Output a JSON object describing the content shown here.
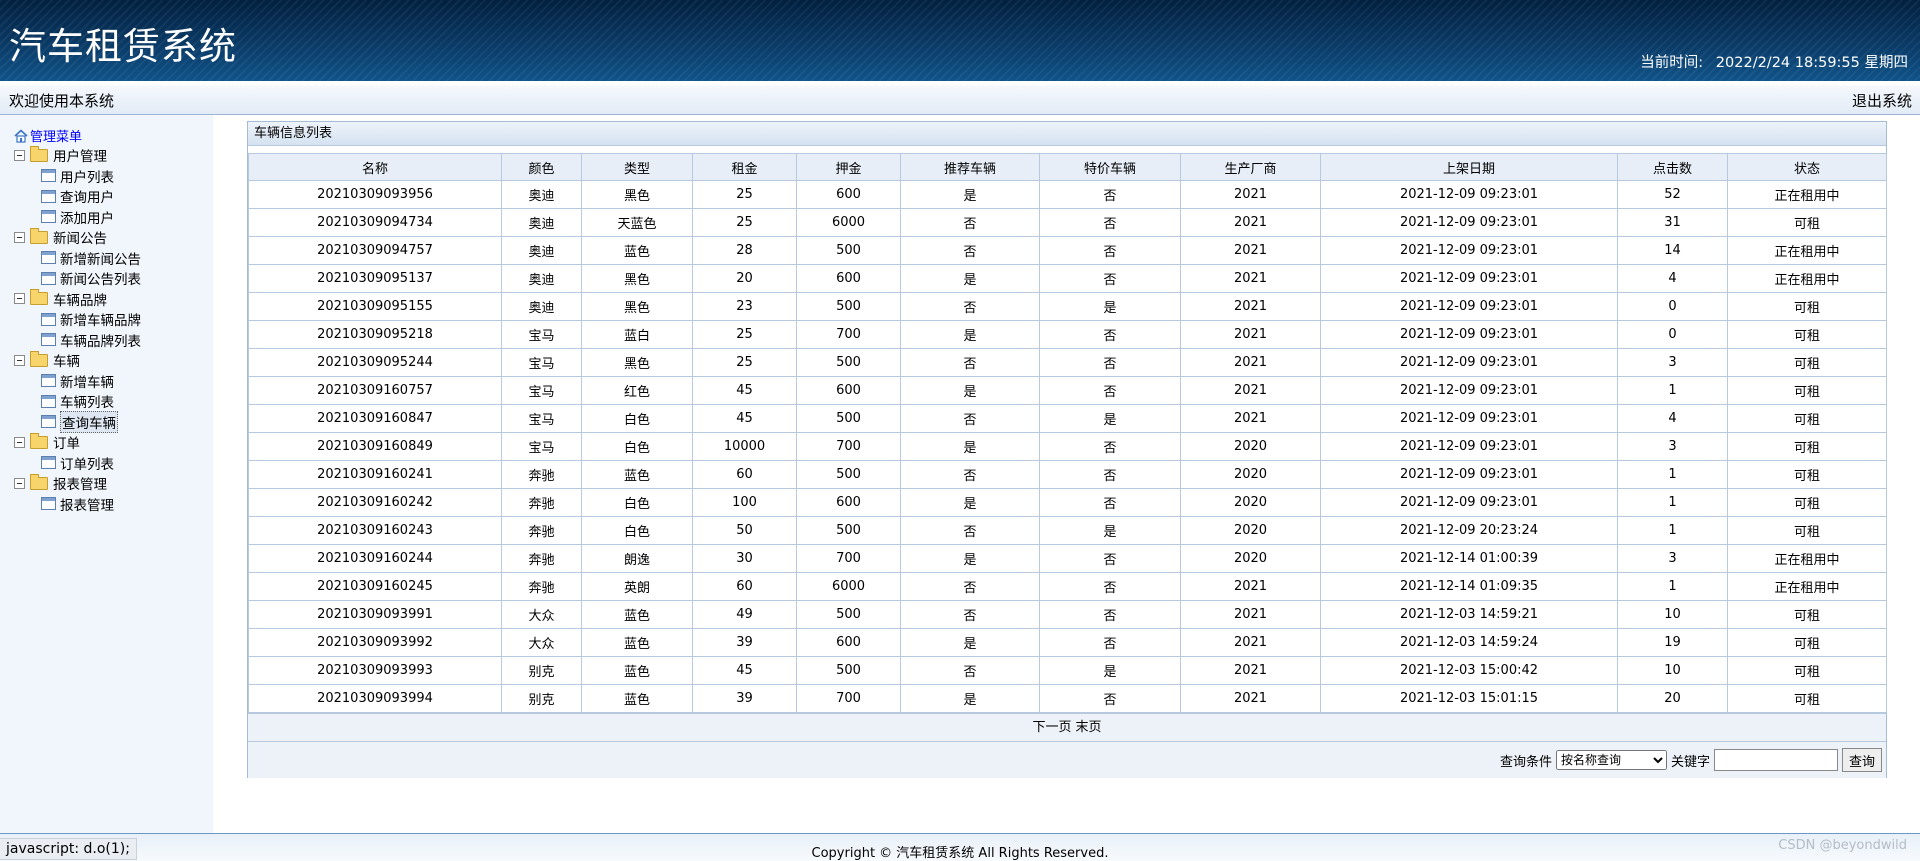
{
  "header": {
    "title": "汽车租赁系统",
    "clock_label": "当前时间:",
    "clock_value": "2022/2/24 18:59:55 星期四"
  },
  "welcome": {
    "text": "欢迎使用本系统",
    "logout": "退出系统"
  },
  "sidebar": {
    "root": "管理菜单",
    "groups": [
      {
        "label": "用户管理",
        "items": [
          "用户列表",
          "查询用户",
          "添加用户"
        ]
      },
      {
        "label": "新闻公告",
        "items": [
          "新增新闻公告",
          "新闻公告列表"
        ]
      },
      {
        "label": "车辆品牌",
        "items": [
          "新增车辆品牌",
          "车辆品牌列表"
        ]
      },
      {
        "label": "车辆",
        "items": [
          "新增车辆",
          "车辆列表",
          "查询车辆"
        ]
      },
      {
        "label": "订单",
        "items": [
          "订单列表"
        ]
      },
      {
        "label": "报表管理",
        "items": [
          "报表管理"
        ]
      }
    ],
    "selected_item": "查询车辆"
  },
  "panel": {
    "title": "车辆信息列表"
  },
  "table": {
    "columns": [
      "名称",
      "颜色",
      "类型",
      "租金",
      "押金",
      "推荐车辆",
      "特价车辆",
      "生产厂商",
      "上架日期",
      "点击数",
      "状态"
    ],
    "rows": [
      [
        "20210309093956",
        "奥迪",
        "黑色",
        "25",
        "600",
        "是",
        "否",
        "2021",
        "2021-12-09 09:23:01",
        "52",
        "正在租用中"
      ],
      [
        "20210309094734",
        "奥迪",
        "天蓝色",
        "25",
        "6000",
        "否",
        "否",
        "2021",
        "2021-12-09 09:23:01",
        "31",
        "可租"
      ],
      [
        "20210309094757",
        "奥迪",
        "蓝色",
        "28",
        "500",
        "否",
        "否",
        "2021",
        "2021-12-09 09:23:01",
        "14",
        "正在租用中"
      ],
      [
        "20210309095137",
        "奥迪",
        "黑色",
        "20",
        "600",
        "是",
        "否",
        "2021",
        "2021-12-09 09:23:01",
        "4",
        "正在租用中"
      ],
      [
        "20210309095155",
        "奥迪",
        "黑色",
        "23",
        "500",
        "否",
        "是",
        "2021",
        "2021-12-09 09:23:01",
        "0",
        "可租"
      ],
      [
        "20210309095218",
        "宝马",
        "蓝白",
        "25",
        "700",
        "是",
        "否",
        "2021",
        "2021-12-09 09:23:01",
        "0",
        "可租"
      ],
      [
        "20210309095244",
        "宝马",
        "黑色",
        "25",
        "500",
        "否",
        "否",
        "2021",
        "2021-12-09 09:23:01",
        "3",
        "可租"
      ],
      [
        "20210309160757",
        "宝马",
        "红色",
        "45",
        "600",
        "是",
        "否",
        "2021",
        "2021-12-09 09:23:01",
        "1",
        "可租"
      ],
      [
        "20210309160847",
        "宝马",
        "白色",
        "45",
        "500",
        "否",
        "是",
        "2021",
        "2021-12-09 09:23:01",
        "4",
        "可租"
      ],
      [
        "20210309160849",
        "宝马",
        "白色",
        "10000",
        "700",
        "是",
        "否",
        "2020",
        "2021-12-09 09:23:01",
        "3",
        "可租"
      ],
      [
        "20210309160241",
        "奔驰",
        "蓝色",
        "60",
        "500",
        "否",
        "否",
        "2020",
        "2021-12-09 09:23:01",
        "1",
        "可租"
      ],
      [
        "20210309160242",
        "奔驰",
        "白色",
        "100",
        "600",
        "是",
        "否",
        "2020",
        "2021-12-09 09:23:01",
        "1",
        "可租"
      ],
      [
        "20210309160243",
        "奔驰",
        "白色",
        "50",
        "500",
        "否",
        "是",
        "2020",
        "2021-12-09 20:23:24",
        "1",
        "可租"
      ],
      [
        "20210309160244",
        "奔驰",
        "朗逸",
        "30",
        "700",
        "是",
        "否",
        "2020",
        "2021-12-14 01:00:39",
        "3",
        "正在租用中"
      ],
      [
        "20210309160245",
        "奔驰",
        "英朗",
        "60",
        "6000",
        "否",
        "否",
        "2021",
        "2021-12-14 01:09:35",
        "1",
        "正在租用中"
      ],
      [
        "20210309093991",
        "大众",
        "蓝色",
        "49",
        "500",
        "否",
        "否",
        "2021",
        "2021-12-03 14:59:21",
        "10",
        "可租"
      ],
      [
        "20210309093992",
        "大众",
        "蓝色",
        "39",
        "600",
        "是",
        "否",
        "2021",
        "2021-12-03 14:59:24",
        "19",
        "可租"
      ],
      [
        "20210309093993",
        "别克",
        "蓝色",
        "45",
        "500",
        "否",
        "是",
        "2021",
        "2021-12-03 15:00:42",
        "10",
        "可租"
      ],
      [
        "20210309093994",
        "别克",
        "蓝色",
        "39",
        "700",
        "是",
        "否",
        "2021",
        "2021-12-03 15:01:15",
        "20",
        "可租"
      ]
    ]
  },
  "pager": {
    "next": "下一页",
    "last": "末页"
  },
  "search": {
    "condition_label": "查询条件",
    "condition_selected": "按名称查询",
    "keyword_label": "关键字",
    "keyword_value": "",
    "submit_label": "查询"
  },
  "footer": {
    "status": "javascript: d.o(1);",
    "copyright": "Copyright © 汽车租赁系统 All Rights Reserved.",
    "watermark": "CSDN @beyondwild"
  },
  "colors": {
    "header_dark": "#02203f",
    "header_light": "#0f5389",
    "sidebar_bg": "#f1f6fc",
    "tree_root_link": "#0000ff",
    "table_border": "#b7c9de"
  },
  "icons": {
    "root": "home-icon",
    "group": "folder-icon",
    "item": "page-icon",
    "expander": "collapse-icon"
  }
}
